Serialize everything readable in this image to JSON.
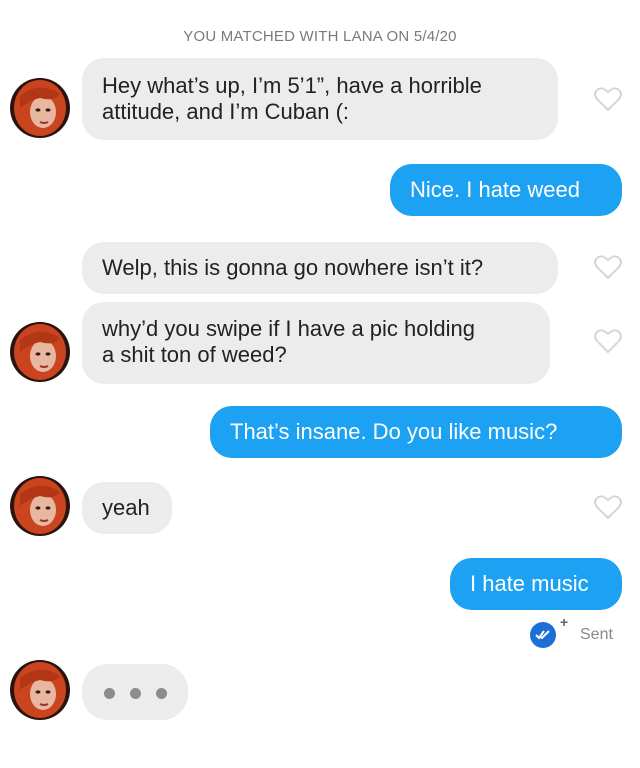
{
  "header": {
    "match_text": "YOU MATCHED WITH LANA ON 5/4/20"
  },
  "messages": [
    {
      "from": "them",
      "lines": [
        "Hey what’s up, I’m 5’1”, have a horrible",
        "attitude, and I’m Cuban (:"
      ]
    },
    {
      "from": "me",
      "lines": [
        "Nice. I hate weed"
      ]
    },
    {
      "from": "them",
      "lines": [
        "Welp, this is gonna go nowhere isn’t it?"
      ]
    },
    {
      "from": "them",
      "lines": [
        "why’d you swipe if I have a pic holding",
        "a shit ton of weed?"
      ]
    },
    {
      "from": "me",
      "lines": [
        "That’s insane. Do you like music?"
      ]
    },
    {
      "from": "them",
      "lines": [
        "yeah"
      ]
    },
    {
      "from": "me",
      "lines": [
        "I hate music"
      ]
    }
  ],
  "status": {
    "label": "Sent",
    "plus": "+"
  },
  "colors": {
    "outgoing": "#1da1f2",
    "incoming": "#ececec",
    "read_check": "#1b6fd6"
  },
  "icons": {
    "like": "heart-outline-icon",
    "receipt": "double-check-icon",
    "typing": "typing-dots-icon"
  }
}
